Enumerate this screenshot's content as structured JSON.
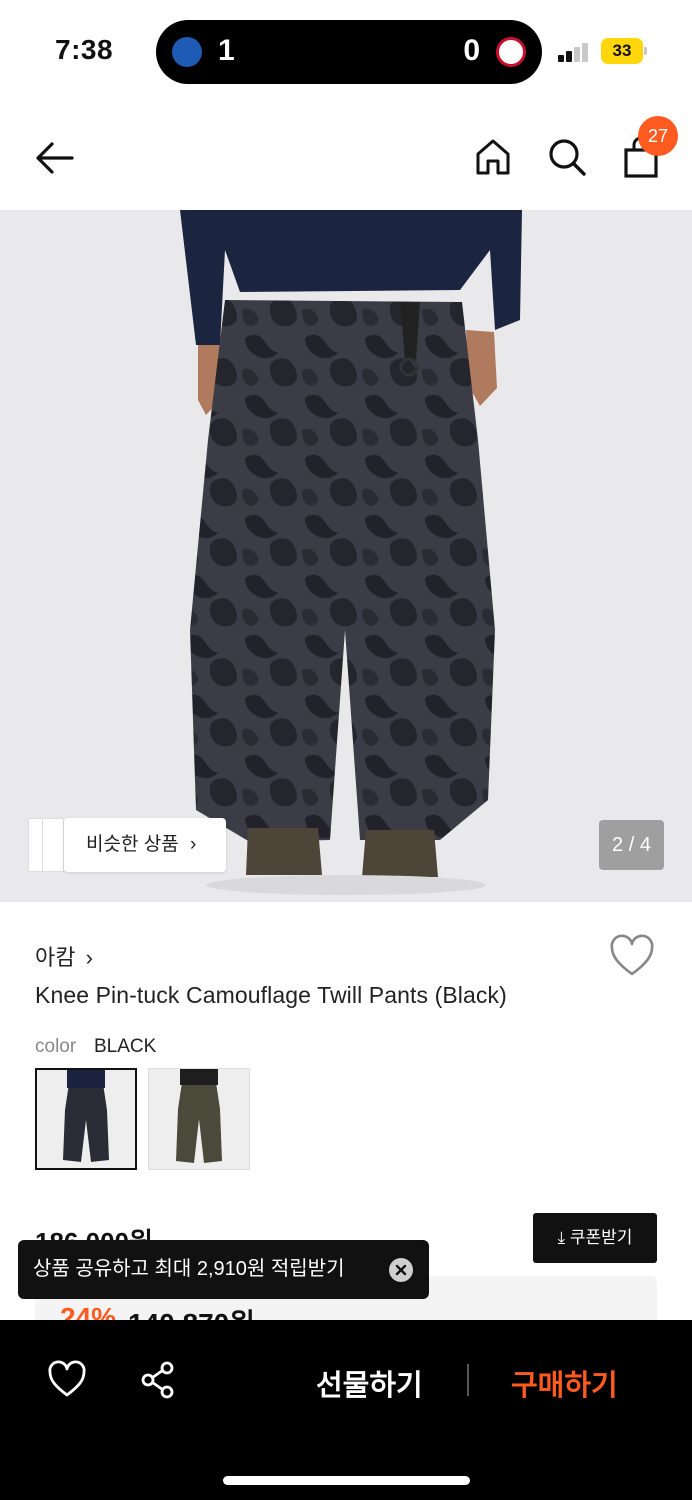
{
  "status_bar": {
    "time": "7:38",
    "score_left": "1",
    "score_right": "0",
    "battery": "33",
    "colors": {
      "battery": "#ffd60a"
    }
  },
  "header": {
    "cart_count": "27",
    "icons": [
      "back-arrow-icon",
      "home-icon",
      "search-icon",
      "shopping-bag-icon"
    ],
    "accent": "#ff5a1f"
  },
  "gallery": {
    "similar_label": "비슷한 상품",
    "counter": "2 / 4"
  },
  "product": {
    "brand": "아캄",
    "name": "Knee Pin-tuck Camouflage Twill Pants (Black)",
    "color_label": "color",
    "color_value": "BLACK"
  },
  "price": {
    "original": "186,000원",
    "coupon_label": "쿠폰받기",
    "sale_rate": "24%",
    "sale_price": "140,870원"
  },
  "toast": {
    "text": "상품 공유하고 최대 2,910원 적립받기"
  },
  "bottom_bar": {
    "gift_label": "선물하기",
    "buy_label": "구매하기",
    "icons": [
      "heart-icon",
      "share-icon"
    ],
    "buy_color": "#ff5a1f"
  }
}
